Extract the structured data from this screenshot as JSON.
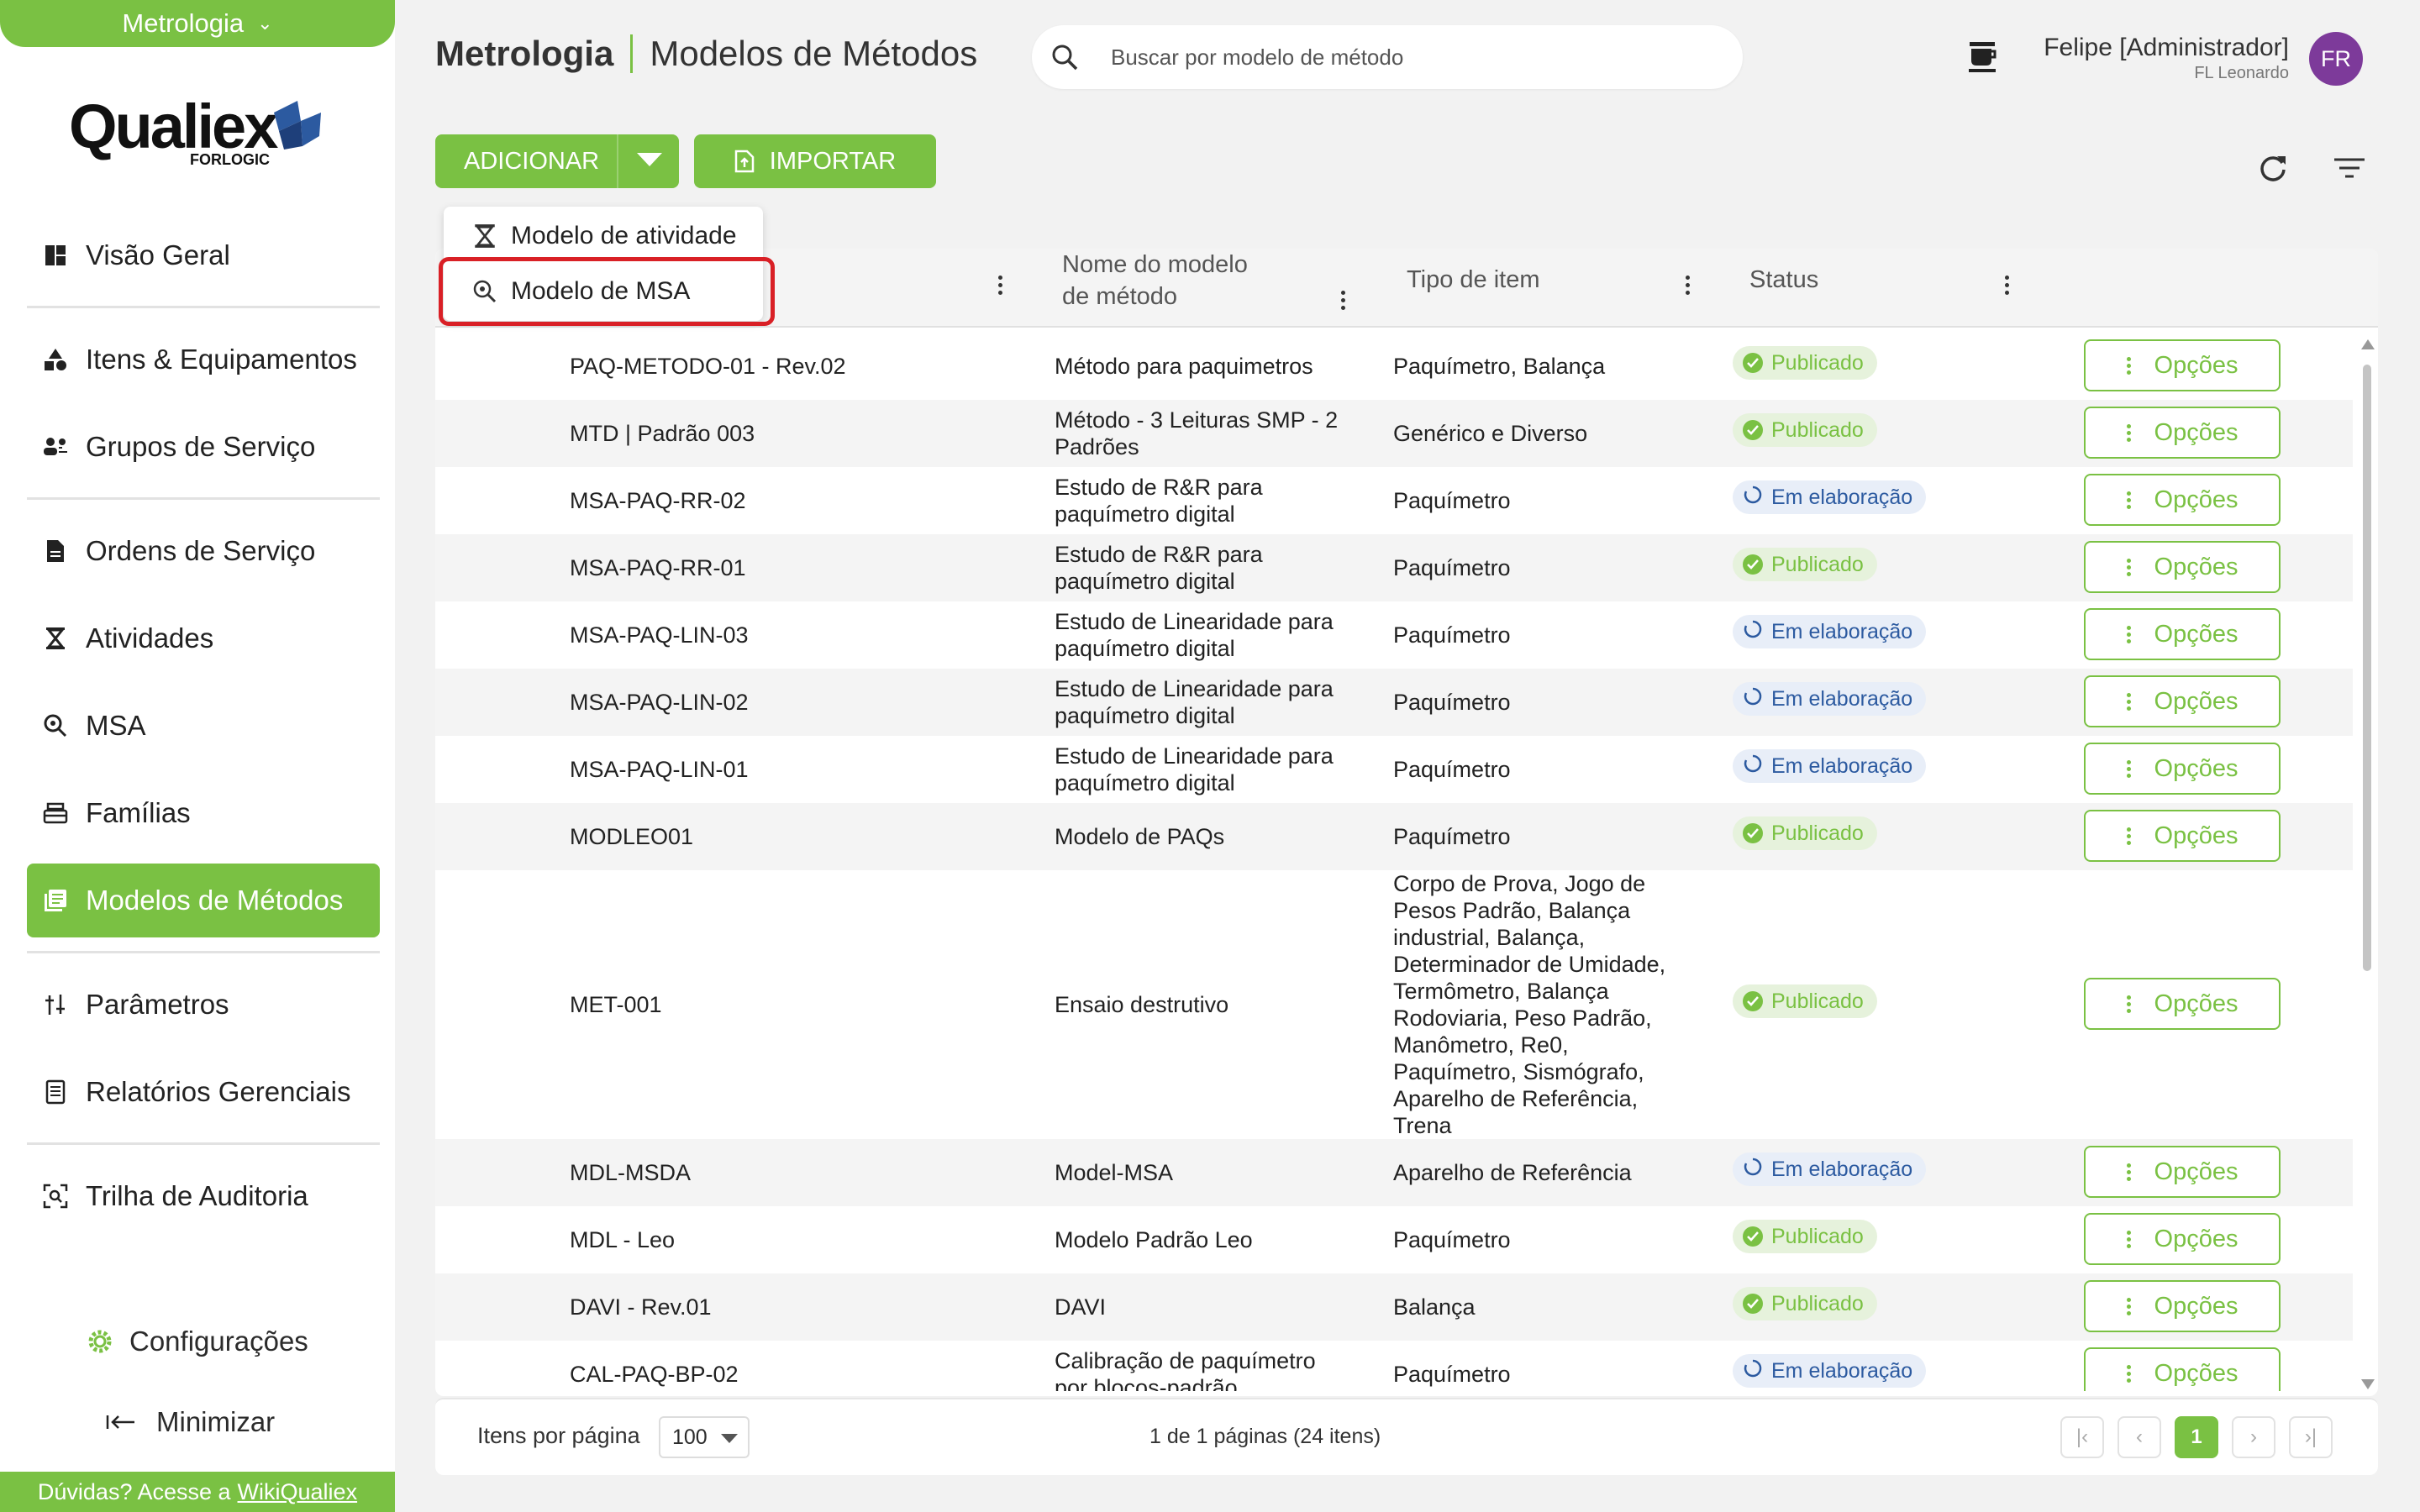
{
  "sidebar": {
    "module": "Metrologia",
    "logo_word": "Qualiex",
    "logo_sub": "FORLOGIC",
    "items": [
      {
        "label": "Visão Geral"
      },
      {
        "label": "Itens & Equipamentos"
      },
      {
        "label": "Grupos de Serviço"
      },
      {
        "label": "Ordens de Serviço"
      },
      {
        "label": "Atividades"
      },
      {
        "label": "MSA"
      },
      {
        "label": "Famílias"
      },
      {
        "label": "Modelos de Métodos"
      },
      {
        "label": "Parâmetros"
      },
      {
        "label": "Relatórios Gerenciais"
      },
      {
        "label": "Trilha de Auditoria"
      }
    ],
    "config": "Configurações",
    "minimize": "Minimizar",
    "help_prefix": "Dúvidas? Acesse a",
    "help_link": "WikiQualiex"
  },
  "header": {
    "module": "Metrologia",
    "page": "Modelos de Métodos",
    "search_placeholder": "Buscar por modelo de método",
    "user_name": "Felipe [Administrador]",
    "user_org": "FL Leonardo",
    "avatar": "FR"
  },
  "toolbar": {
    "add": "ADICIONAR",
    "import": "IMPORTAR"
  },
  "dropdown": {
    "items": [
      "Modelo de atividade",
      "Modelo de MSA"
    ]
  },
  "table": {
    "columns": {
      "name_l1": "Nome do modelo",
      "name_l2": "de método",
      "type": "Tipo de item",
      "status": "Status"
    },
    "options_label": "Opções",
    "rows": [
      {
        "code": "PAQ-METODO-01 - Rev.02",
        "name": "Método para paquimetros",
        "type": "Paquímetro, Balança",
        "status": "Publicado",
        "state": "pub"
      },
      {
        "code": "MTD | Padrão 003",
        "name": "Método - 3 Leituras SMP - 2 Padrões",
        "type": "Genérico e Diverso",
        "status": "Publicado",
        "state": "pub"
      },
      {
        "code": "MSA-PAQ-RR-02",
        "name": "Estudo de R&R para paquímetro digital",
        "type": "Paquímetro",
        "status": "Em elaboração",
        "state": "elab"
      },
      {
        "code": "MSA-PAQ-RR-01",
        "name": "Estudo de R&R para paquímetro digital",
        "type": "Paquímetro",
        "status": "Publicado",
        "state": "pub"
      },
      {
        "code": "MSA-PAQ-LIN-03",
        "name": "Estudo de Linearidade para paquímetro digital",
        "type": "Paquímetro",
        "status": "Em elaboração",
        "state": "elab"
      },
      {
        "code": "MSA-PAQ-LIN-02",
        "name": "Estudo de Linearidade para paquímetro digital",
        "type": "Paquímetro",
        "status": "Em elaboração",
        "state": "elab"
      },
      {
        "code": "MSA-PAQ-LIN-01",
        "name": "Estudo de Linearidade para paquímetro digital",
        "type": "Paquímetro",
        "status": "Em elaboração",
        "state": "elab"
      },
      {
        "code": "MODLEO01",
        "name": "Modelo de PAQs",
        "type": "Paquímetro",
        "status": "Publicado",
        "state": "pub"
      },
      {
        "code": "MET-001",
        "name": "Ensaio destrutivo",
        "type": "Corpo de Prova, Jogo de Pesos Padrão, Balança industrial, Balança, Determinador de Umidade, Termômetro, Balança Rodoviaria, Peso Padrão, Manômetro, Re0, Paquímetro, Sismógrafo, Aparelho de Referência, Trena",
        "status": "Publicado",
        "state": "pub"
      },
      {
        "code": "MDL-MSDA",
        "name": "Model-MSA",
        "type": "Aparelho de Referência",
        "status": "Em elaboração",
        "state": "elab"
      },
      {
        "code": "MDL - Leo",
        "name": "Modelo Padrão Leo",
        "type": "Paquímetro",
        "status": "Publicado",
        "state": "pub"
      },
      {
        "code": "DAVI - Rev.01",
        "name": "DAVI",
        "type": "Balança",
        "status": "Publicado",
        "state": "pub"
      },
      {
        "code": "CAL-PAQ-BP-02",
        "name": "Calibração de paquímetro por blocos-padrão",
        "type": "Paquímetro",
        "status": "Em elaboração",
        "state": "elab"
      }
    ]
  },
  "footer": {
    "per_page_label": "Itens por página",
    "per_page_value": "100",
    "pages_info": "1 de 1 páginas (24 itens)",
    "current_page": "1"
  },
  "colors": {
    "brand": "#7ac143",
    "highlight": "#d92026",
    "avatar": "#7d3a9a"
  }
}
